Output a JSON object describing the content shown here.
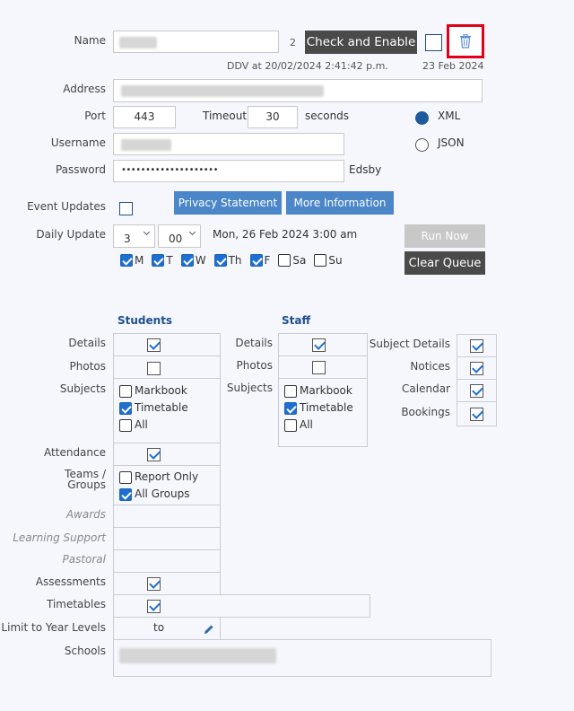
{
  "form": {
    "name": {
      "label": "Name",
      "count": "2"
    },
    "check_enable_label": "Check and Enable",
    "last_check": "DDV at 20/02/2024 2:41:42 p.m.",
    "date_right": "23 Feb 2024",
    "address": {
      "label": "Address"
    },
    "port": {
      "label": "Port",
      "value": "443"
    },
    "timeout": {
      "label": "Timeout",
      "value": "30",
      "unit": "seconds"
    },
    "format": {
      "xml": "XML",
      "json": "JSON",
      "selected": "XML"
    },
    "username": {
      "label": "Username"
    },
    "password": {
      "label": "Password",
      "masked": "••••••••••••••••••••",
      "suffix": "Edsby"
    },
    "event_updates": {
      "label": "Event Updates",
      "checked": false
    },
    "privacy_label": "Privacy Statement",
    "more_info_label": "More Information",
    "daily_update": {
      "label": "Daily Update",
      "hour": "3",
      "minute": "00",
      "next_run": "Mon, 26 Feb 2024 3:00 am"
    },
    "run_now_label": "Run Now",
    "clear_queue_label": "Clear Queue",
    "days": [
      {
        "label": "M",
        "checked": true
      },
      {
        "label": "T",
        "checked": true
      },
      {
        "label": "W",
        "checked": true
      },
      {
        "label": "Th",
        "checked": true
      },
      {
        "label": "F",
        "checked": true
      },
      {
        "label": "Sa",
        "checked": false
      },
      {
        "label": "Su",
        "checked": false
      }
    ]
  },
  "students": {
    "header": "Students",
    "details": {
      "label": "Details",
      "checked": true
    },
    "photos": {
      "label": "Photos",
      "checked": false
    },
    "subjects": {
      "label": "Subjects",
      "markbook": "Markbook",
      "timetable": "Timetable",
      "all": "All"
    },
    "attendance": {
      "label": "Attendance",
      "checked": true
    },
    "teams": {
      "label_line1": "Teams /",
      "label_line2": "Groups",
      "report_only": "Report Only",
      "all_groups": "All Groups"
    },
    "awards": "Awards",
    "learning_support": "Learning Support",
    "pastoral": "Pastoral",
    "assessments": {
      "label": "Assessments",
      "checked": true
    },
    "timetables": {
      "label": "Timetables",
      "checked": true
    },
    "limit_year": {
      "label": "Limit to Year Levels",
      "to": "to"
    },
    "schools": {
      "label": "Schools"
    }
  },
  "staff": {
    "header": "Staff",
    "details": {
      "label": "Details",
      "checked": true
    },
    "photos": {
      "label": "Photos",
      "checked": false
    },
    "subjects": {
      "label": "Subjects",
      "markbook": "Markbook",
      "timetable": "Timetable",
      "all": "All"
    }
  },
  "other": {
    "subject_details": "Subject Details",
    "notices": "Notices",
    "calendar": "Calendar",
    "bookings": "Bookings"
  },
  "colors": {
    "accent": "#4a86c8",
    "dark_button": "#4a4a4a",
    "header_blue": "#1f4f8f",
    "highlight_red": "#e0001a"
  }
}
